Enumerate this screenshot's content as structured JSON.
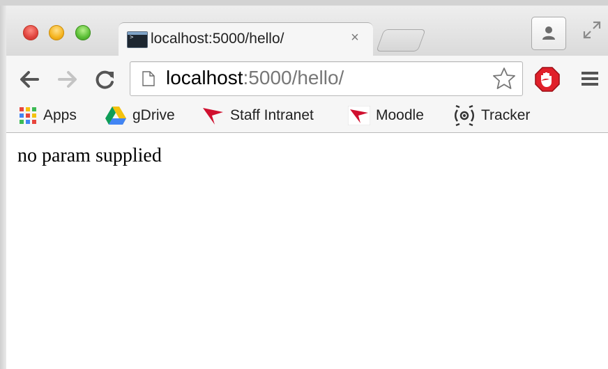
{
  "tab": {
    "title": "localhost:5000/hello/",
    "close_symbol": "×"
  },
  "omnibox": {
    "host": "localhost",
    "rest": ":5000/hello/"
  },
  "bookmarks": [
    {
      "label": "Apps",
      "icon": "apps-grid-icon"
    },
    {
      "label": "gDrive",
      "icon": "google-drive-icon"
    },
    {
      "label": "Staff Intranet",
      "icon": "red-flag-icon"
    },
    {
      "label": "Moodle",
      "icon": "moodle-flag-icon"
    },
    {
      "label": "Tracker",
      "icon": "tracker-icon"
    }
  ],
  "page": {
    "text": "no param supplied"
  },
  "colors": {
    "adblock_red": "#e0202a",
    "flag_red": "#d0102f",
    "drive_yellow": "#f4c20d",
    "drive_green": "#0f9d58",
    "drive_blue": "#4285f4"
  }
}
